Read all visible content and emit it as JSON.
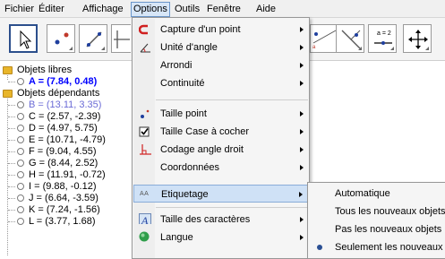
{
  "menubar": {
    "items": [
      "Fichier",
      "Éditer",
      "Affichage",
      "Options",
      "Outils",
      "Fenêtre",
      "Aide"
    ]
  },
  "toolbar": {
    "tools": [
      "move-tool",
      "point-tool",
      "line-tool",
      "perpendicular-tool",
      "polygon-tool",
      "circle-tool",
      "angle-tool",
      "reflect-tool",
      "slider-tool",
      "move-graphics-tool"
    ],
    "slider_text": "a = 2"
  },
  "algebra": {
    "free_folder": "Objets libres",
    "free_objects": [
      "A = (7.84, 0.48)"
    ],
    "dependent_folder": "Objets dépendants",
    "dependent_objects": [
      "B = (13.11, 3.35)",
      "C = (2.57, -2.39)",
      "D = (4.97, 5.75)",
      "E = (10.71, -4.79)",
      "F = (9.04, 4.55)",
      "G = (8.44, 2.52)",
      "H = (11.91, -0.72)",
      "I = (9.88, -0.12)",
      "J = (6.64, -3.59)",
      "K = (7.24, -1.56)",
      "L = (3.77, 1.68)"
    ],
    "free_color": "#0000ff",
    "dependent_first_color": "#6b6bd6"
  },
  "options_menu": {
    "items": [
      {
        "label": "Capture d'un point",
        "icon": "magnet-icon"
      },
      {
        "label": "Unité d'angle",
        "icon": "angle-icon"
      },
      {
        "label": "Arrondi",
        "icon": ""
      },
      {
        "label": "Continuité",
        "icon": ""
      },
      {
        "label": "Taille point",
        "icon": "point-size-icon"
      },
      {
        "label": "Taille Case à cocher",
        "icon": "checkbox-icon"
      },
      {
        "label": "Codage angle droit",
        "icon": "right-angle-icon"
      },
      {
        "label": "Coordonnées",
        "icon": ""
      },
      {
        "label": "Etiquetage",
        "icon": "label-icon"
      },
      {
        "label": "Taille des caractères",
        "icon": "font-size-icon"
      },
      {
        "label": "Langue",
        "icon": "globe-icon"
      }
    ]
  },
  "label_submenu": {
    "items": [
      "Automatique",
      "Tous les nouveaux objets",
      "Pas les nouveaux objets",
      "Seulement les nouveaux points"
    ],
    "selected_index": 3
  },
  "colors": {
    "menu_highlight": "#cfe1f6",
    "accent": "#2a4f93"
  }
}
